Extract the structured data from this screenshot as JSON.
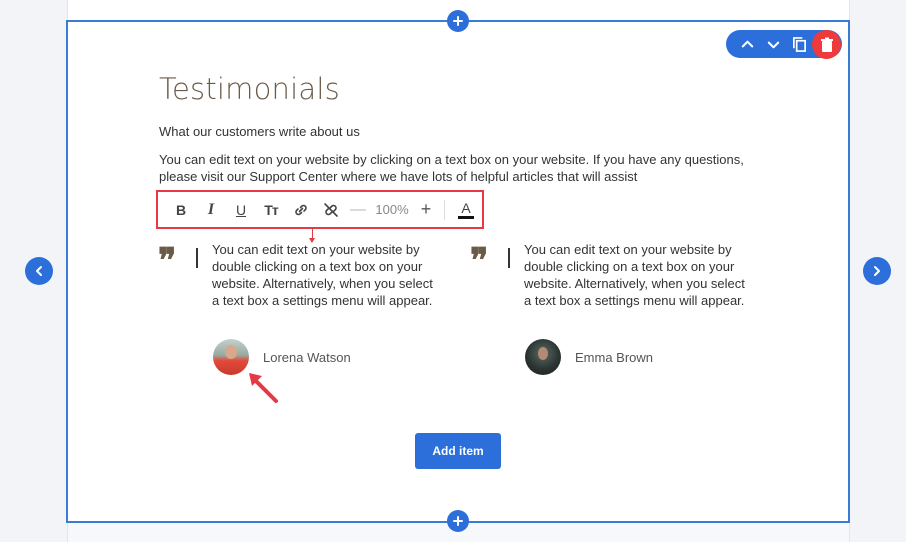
{
  "section": {
    "title": "Testimonials",
    "subtitle": "What our customers write about us",
    "paragraph": "You can edit text on your website by clicking on a text box on your website. If you have any questions, please visit our Support Center where we have lots of helpful articles that will assist"
  },
  "format_toolbar": {
    "bold_label": "B",
    "italic_label": "I",
    "underline_label": "U",
    "text_size_label": "Tт",
    "decrease_label": "—",
    "zoom_value": "100%",
    "increase_label": "+",
    "text_color_label": "A"
  },
  "testimonials": [
    {
      "text": "You can edit text on your website by double clicking on a text box on your website. Alternatively, when you select a text box a settings menu will appear.",
      "name": "Lorena Watson"
    },
    {
      "text": "You can edit text on your website by double clicking on a text box on your website. Alternatively, when you select a text box a settings menu will appear.",
      "name": "Emma Brown"
    }
  ],
  "add_item_label": "Add item",
  "icons": {
    "add_top": "plus-icon",
    "add_bottom": "plus-icon",
    "prev": "chevron-left-icon",
    "next": "chevron-right-icon",
    "move_up": "chevron-up-icon",
    "move_down": "chevron-down-icon",
    "duplicate": "copy-icon",
    "delete": "trash-icon",
    "link": "link-icon",
    "unlink": "unlink-icon",
    "quote": "quote-icon"
  },
  "colors": {
    "accent": "#2c6fdb",
    "selection_border": "#3a7bd5",
    "delete": "#ee3a3a",
    "highlight": "#e53946",
    "heading": "#6b5a48"
  }
}
